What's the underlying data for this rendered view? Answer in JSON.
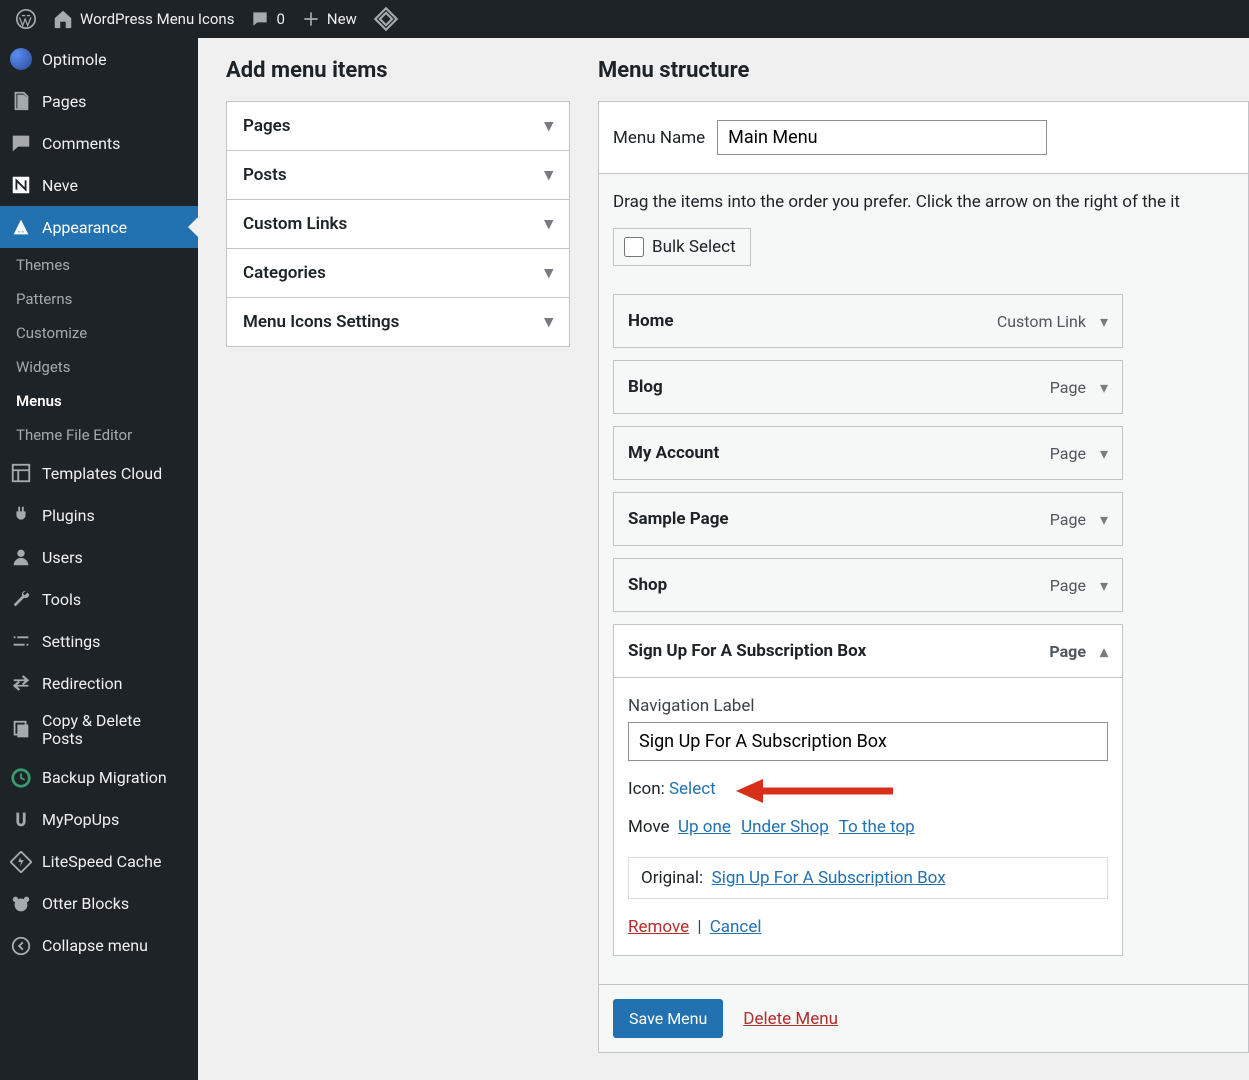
{
  "adminbar": {
    "site_title": "WordPress Menu Icons",
    "comments_count": "0",
    "new_label": "New"
  },
  "sidebar": {
    "items": [
      {
        "label": "Optimole"
      },
      {
        "label": "Pages"
      },
      {
        "label": "Comments"
      },
      {
        "label": "Neve"
      },
      {
        "label": "Appearance"
      },
      {
        "label": "Templates Cloud"
      },
      {
        "label": "Plugins"
      },
      {
        "label": "Users"
      },
      {
        "label": "Tools"
      },
      {
        "label": "Settings"
      },
      {
        "label": "Redirection"
      },
      {
        "label": "Copy & Delete\nPosts"
      },
      {
        "label": "Backup Migration"
      },
      {
        "label": "MyPopUps"
      },
      {
        "label": "LiteSpeed Cache"
      },
      {
        "label": "Otter Blocks"
      },
      {
        "label": "Collapse menu"
      }
    ],
    "appearance_sub": [
      "Themes",
      "Patterns",
      "Customize",
      "Widgets",
      "Menus",
      "Theme File Editor"
    ]
  },
  "left": {
    "heading": "Add menu items",
    "panels": [
      "Pages",
      "Posts",
      "Custom Links",
      "Categories",
      "Menu Icons Settings"
    ]
  },
  "right": {
    "heading": "Menu structure",
    "menu_name_label": "Menu Name",
    "menu_name_value": "Main Menu",
    "instructions": "Drag the items into the order you prefer. Click the arrow on the right of the it",
    "bulk_select": "Bulk Select",
    "menu_items": [
      {
        "title": "Home",
        "type": "Custom Link"
      },
      {
        "title": "Blog",
        "type": "Page"
      },
      {
        "title": "My Account",
        "type": "Page"
      },
      {
        "title": "Sample Page",
        "type": "Page"
      },
      {
        "title": "Shop",
        "type": "Page"
      },
      {
        "title": "Sign Up For A Subscription Box",
        "type": "Page"
      }
    ],
    "expanded": {
      "nav_label_label": "Navigation Label",
      "nav_label_value": "Sign Up For A Subscription Box",
      "icon_label": "Icon:",
      "icon_select": "Select",
      "move_label": "Move",
      "move_up": "Up one",
      "move_under": "Under Shop",
      "move_top": "To the top",
      "original_label": "Original:",
      "original_link": "Sign Up For A Subscription Box",
      "remove": "Remove",
      "cancel": "Cancel"
    },
    "save_button": "Save Menu",
    "delete_menu": "Delete Menu"
  }
}
